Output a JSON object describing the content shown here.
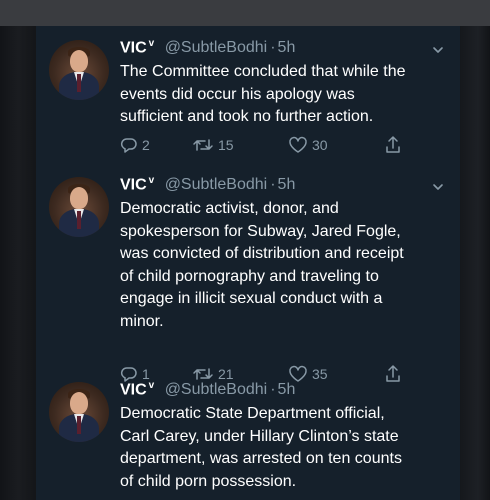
{
  "tweets": [
    {
      "author_name": "VIC",
      "verified_mark": "v",
      "handle": "@SubtleBodhi",
      "separator": "·",
      "time": "5h",
      "lines": [
        "The Committee concluded that while the",
        "events did occur his apology was",
        "sufficient and took no further action."
      ],
      "replies": "2",
      "retweets": "15",
      "likes": "30"
    },
    {
      "author_name": "VIC",
      "verified_mark": "v",
      "handle": "@SubtleBodhi",
      "separator": "·",
      "time": "5h",
      "lines": [
        "Democratic activist, donor, and",
        "spokesperson for Subway, Jared Fogle,",
        "was convicted of distribution and receipt",
        "of child pornography and traveling to",
        "engage in illicit sexual conduct with a",
        "minor."
      ],
      "replies": "1",
      "retweets": "21",
      "likes": "35"
    },
    {
      "author_name": "VIC",
      "verified_mark": "v",
      "handle": "@SubtleBodhi",
      "separator": "·",
      "time": "5h",
      "lines": [
        "Democratic State Department official,",
        "Carl Carey, under Hillary Clinton’s state",
        "department, was arrested on ten counts",
        "of child porn possession."
      ]
    }
  ],
  "colors": {
    "background": "#15202b",
    "text": "#ffffff",
    "secondary_text": "#8899a6",
    "top_bar": "#3a3c40"
  },
  "icons": {
    "reply": "reply-icon",
    "retweet": "retweet-icon",
    "like": "heart-icon",
    "share": "share-icon",
    "menu": "chevron-down-icon"
  }
}
